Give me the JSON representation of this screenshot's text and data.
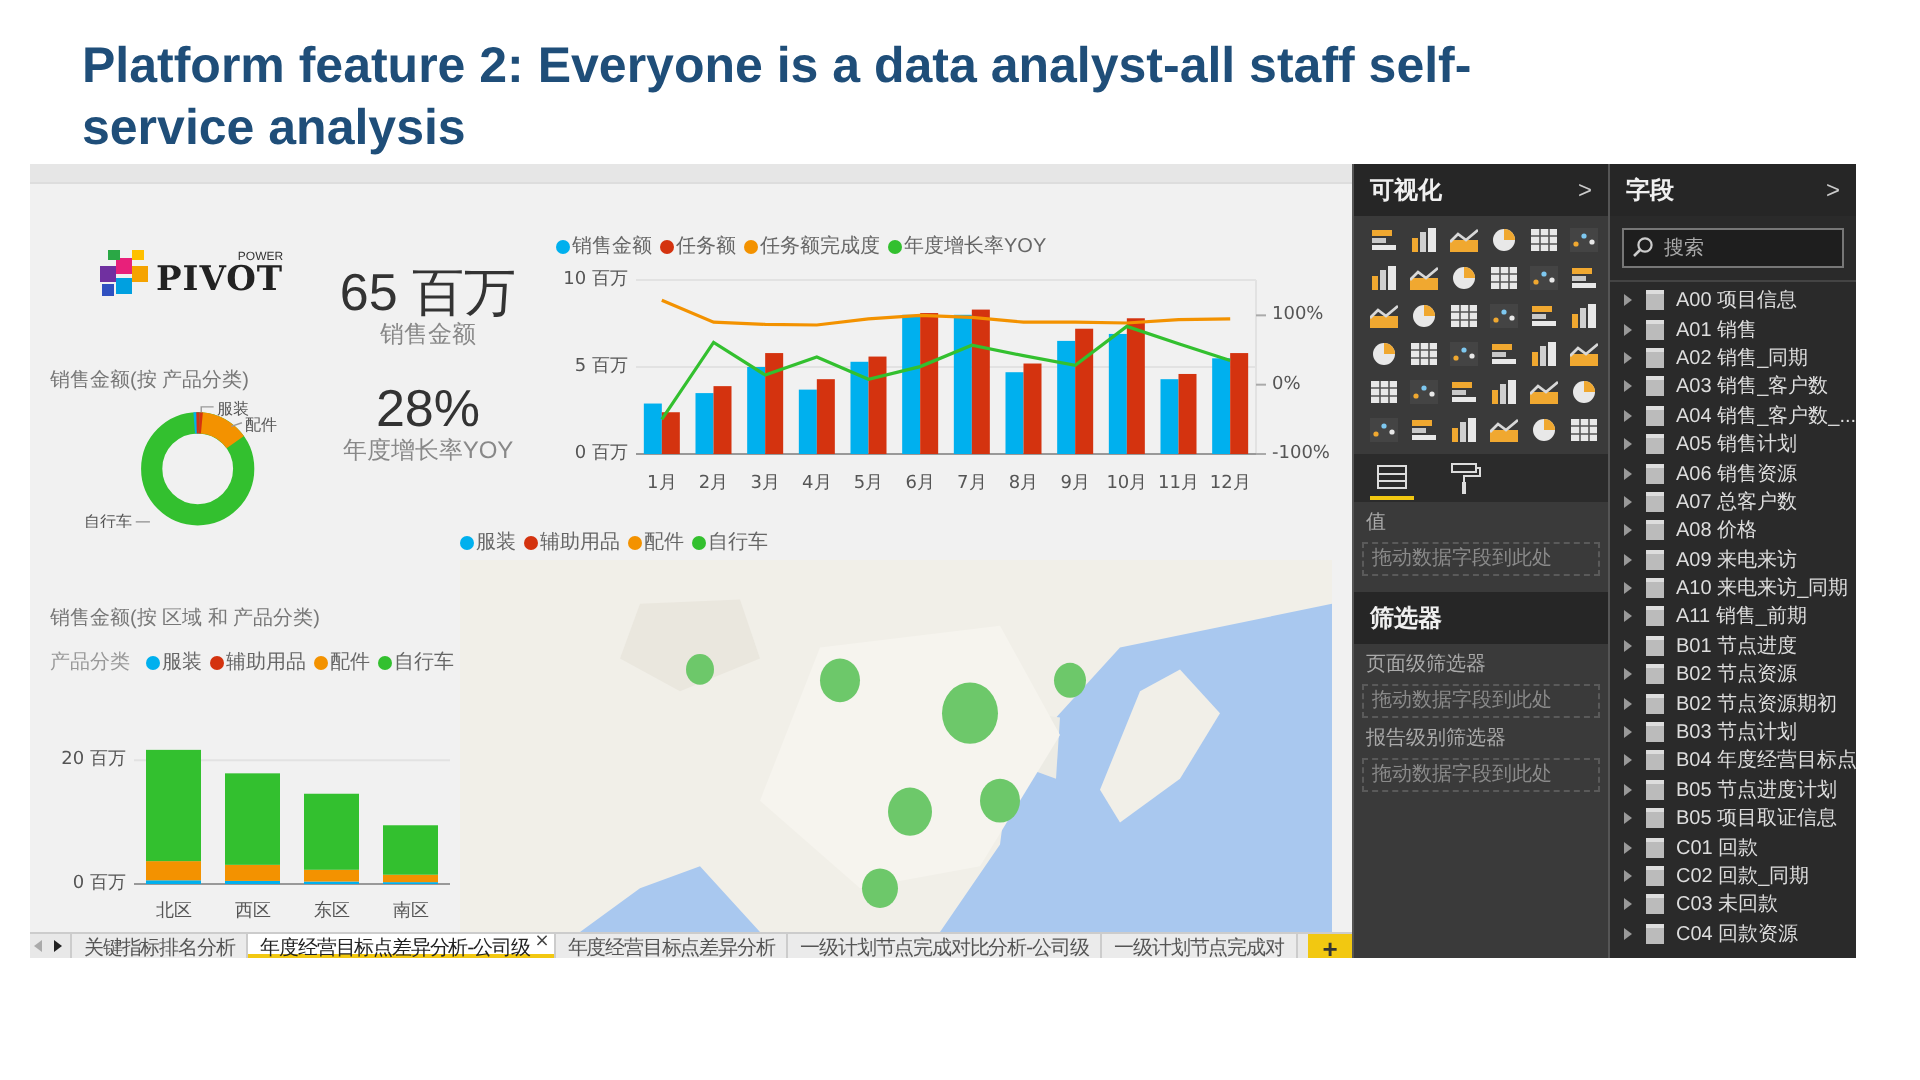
{
  "slide": {
    "title": "Platform feature 2: Everyone is a data analyst-all staff self-service analysis"
  },
  "report": {
    "logo": {
      "small": "POWER",
      "main": "PIVOT"
    },
    "kpis": [
      {
        "value": "65 百万",
        "label": "销售金额"
      },
      {
        "value": "28%",
        "label": "年度增长率YOY"
      }
    ],
    "donut": {
      "title": "销售金额(按 产品分类)",
      "labels": [
        "服装",
        "配件",
        "自行车"
      ]
    },
    "combo": {
      "chart_data": {
        "type": "bar",
        "categories": [
          "1月",
          "2月",
          "3月",
          "4月",
          "5月",
          "6月",
          "7月",
          "8月",
          "9月",
          "10月",
          "11月",
          "12月"
        ],
        "series": [
          {
            "name": "销售金额",
            "color": "#00b0ee",
            "values": [
              2.9,
              3.5,
              5.0,
              3.7,
              5.3,
              8.0,
              8.0,
              4.7,
              6.5,
              6.9,
              4.3,
              5.5
            ]
          },
          {
            "name": "任务额",
            "color": "#d4330f",
            "values": [
              2.4,
              3.9,
              5.8,
              4.3,
              5.6,
              8.1,
              8.3,
              5.2,
              7.2,
              7.8,
              4.6,
              5.8
            ]
          },
          {
            "name": "任务额完成度",
            "color": "#f39200",
            "type": "line",
            "axis": "y2",
            "values": [
              122,
              90,
              87,
              86,
              95,
              100,
              97,
              90,
              90,
              89,
              94,
              95
            ]
          },
          {
            "name": "年度增长率YOY",
            "color": "#33c02f",
            "type": "line",
            "axis": "y2",
            "values": [
              -50,
              61,
              14,
              40,
              8,
              26,
              57,
              42,
              28,
              84,
              59,
              35
            ]
          }
        ],
        "legend": "top",
        "ylim": [
          0,
          10
        ],
        "yticks": [
          {
            "value": 0,
            "label": "0 百万"
          },
          {
            "value": 5,
            "label": "5 百万"
          },
          {
            "value": 10,
            "label": "10 百万"
          }
        ],
        "y2lim": [
          -100,
          151
        ],
        "y2ticks": [
          {
            "value": -100,
            "label": "-100%"
          },
          {
            "value": 0,
            "label": "0%"
          },
          {
            "value": 100,
            "label": "100%"
          }
        ]
      }
    },
    "stacked": {
      "title": "销售金额(按 区域 和 产品分类)",
      "chart_data": {
        "type": "bar",
        "stacked": true,
        "legend_title": "产品分类",
        "categories": [
          "北区",
          "西区",
          "东区",
          "南区"
        ],
        "series": [
          {
            "name": "服装",
            "color": "#00b0ee",
            "values": [
              0.6,
              0.5,
              0.4,
              0.3
            ]
          },
          {
            "name": "辅助用品",
            "color": "#d4330f",
            "values": [
              null,
              null,
              null,
              null
            ]
          },
          {
            "name": "配件",
            "color": "#f39200",
            "values": [
              3.1,
              2.6,
              1.9,
              1.2
            ]
          },
          {
            "name": "自行车",
            "color": "#33c02f",
            "values": [
              18.0,
              14.8,
              12.3,
              8.0
            ]
          }
        ],
        "legend": "top",
        "ylim": [
          0,
          22
        ],
        "yticks": [
          {
            "value": 0,
            "label": "0 百万"
          },
          {
            "value": 20,
            "label": "20 百万"
          }
        ]
      }
    },
    "map": {
      "kind": "picture",
      "legend": [
        {
          "name": "服装",
          "color": "#00b0ee"
        },
        {
          "name": "辅助用品",
          "color": "#d4330f"
        },
        {
          "name": "配件",
          "color": "#f39200"
        },
        {
          "name": "自行车",
          "color": "#33c02f"
        }
      ]
    },
    "tabs": [
      {
        "label": "关键指标排名分析",
        "selected": false
      },
      {
        "label": "年度经营目标点差异分析-公司级",
        "selected": true,
        "close": "×"
      },
      {
        "label": "年度经营目标点差异分析",
        "selected": false
      },
      {
        "label": "一级计划节点完成对比分析-公司级",
        "selected": false
      },
      {
        "label": "一级计划节点完成对",
        "selected": false
      }
    ],
    "add_label": "+"
  },
  "visualizations": {
    "title": "可视化",
    "collapse": ">",
    "tabs": [
      {
        "kind": "fields",
        "selected": true
      },
      {
        "kind": "format",
        "selected": false
      }
    ],
    "value_label": "值",
    "drop_hint": "拖动数据字段到此处"
  },
  "filters": {
    "title": "筛选器",
    "sections": [
      {
        "label": "页面级筛选器",
        "drop_hint": "拖动数据字段到此处"
      },
      {
        "label": "报告级别筛选器",
        "drop_hint": "拖动数据字段到此处"
      }
    ]
  },
  "fields": {
    "title": "字段",
    "collapse": ">",
    "search": {
      "placeholder": "搜索"
    },
    "tables": [
      "A00 项目信息",
      "A01 销售",
      "A02 销售_同期",
      "A03 销售_客户数",
      "A04 销售_客户数_...",
      "A05 销售计划",
      "A06 销售资源",
      "A07 总客户数",
      "A08 价格",
      "A09 来电来访",
      "A10 来电来访_同期",
      "A11 销售_前期",
      "B01 节点进度",
      "B02 节点资源",
      "B02 节点资源期初",
      "B03 节点计划",
      "B04 年度经营目标点",
      "B05 节点进度计划",
      "B05 项目取证信息",
      "C01 回款",
      "C02 回款_同期",
      "C03 未回款",
      "C04 回款资源"
    ]
  }
}
